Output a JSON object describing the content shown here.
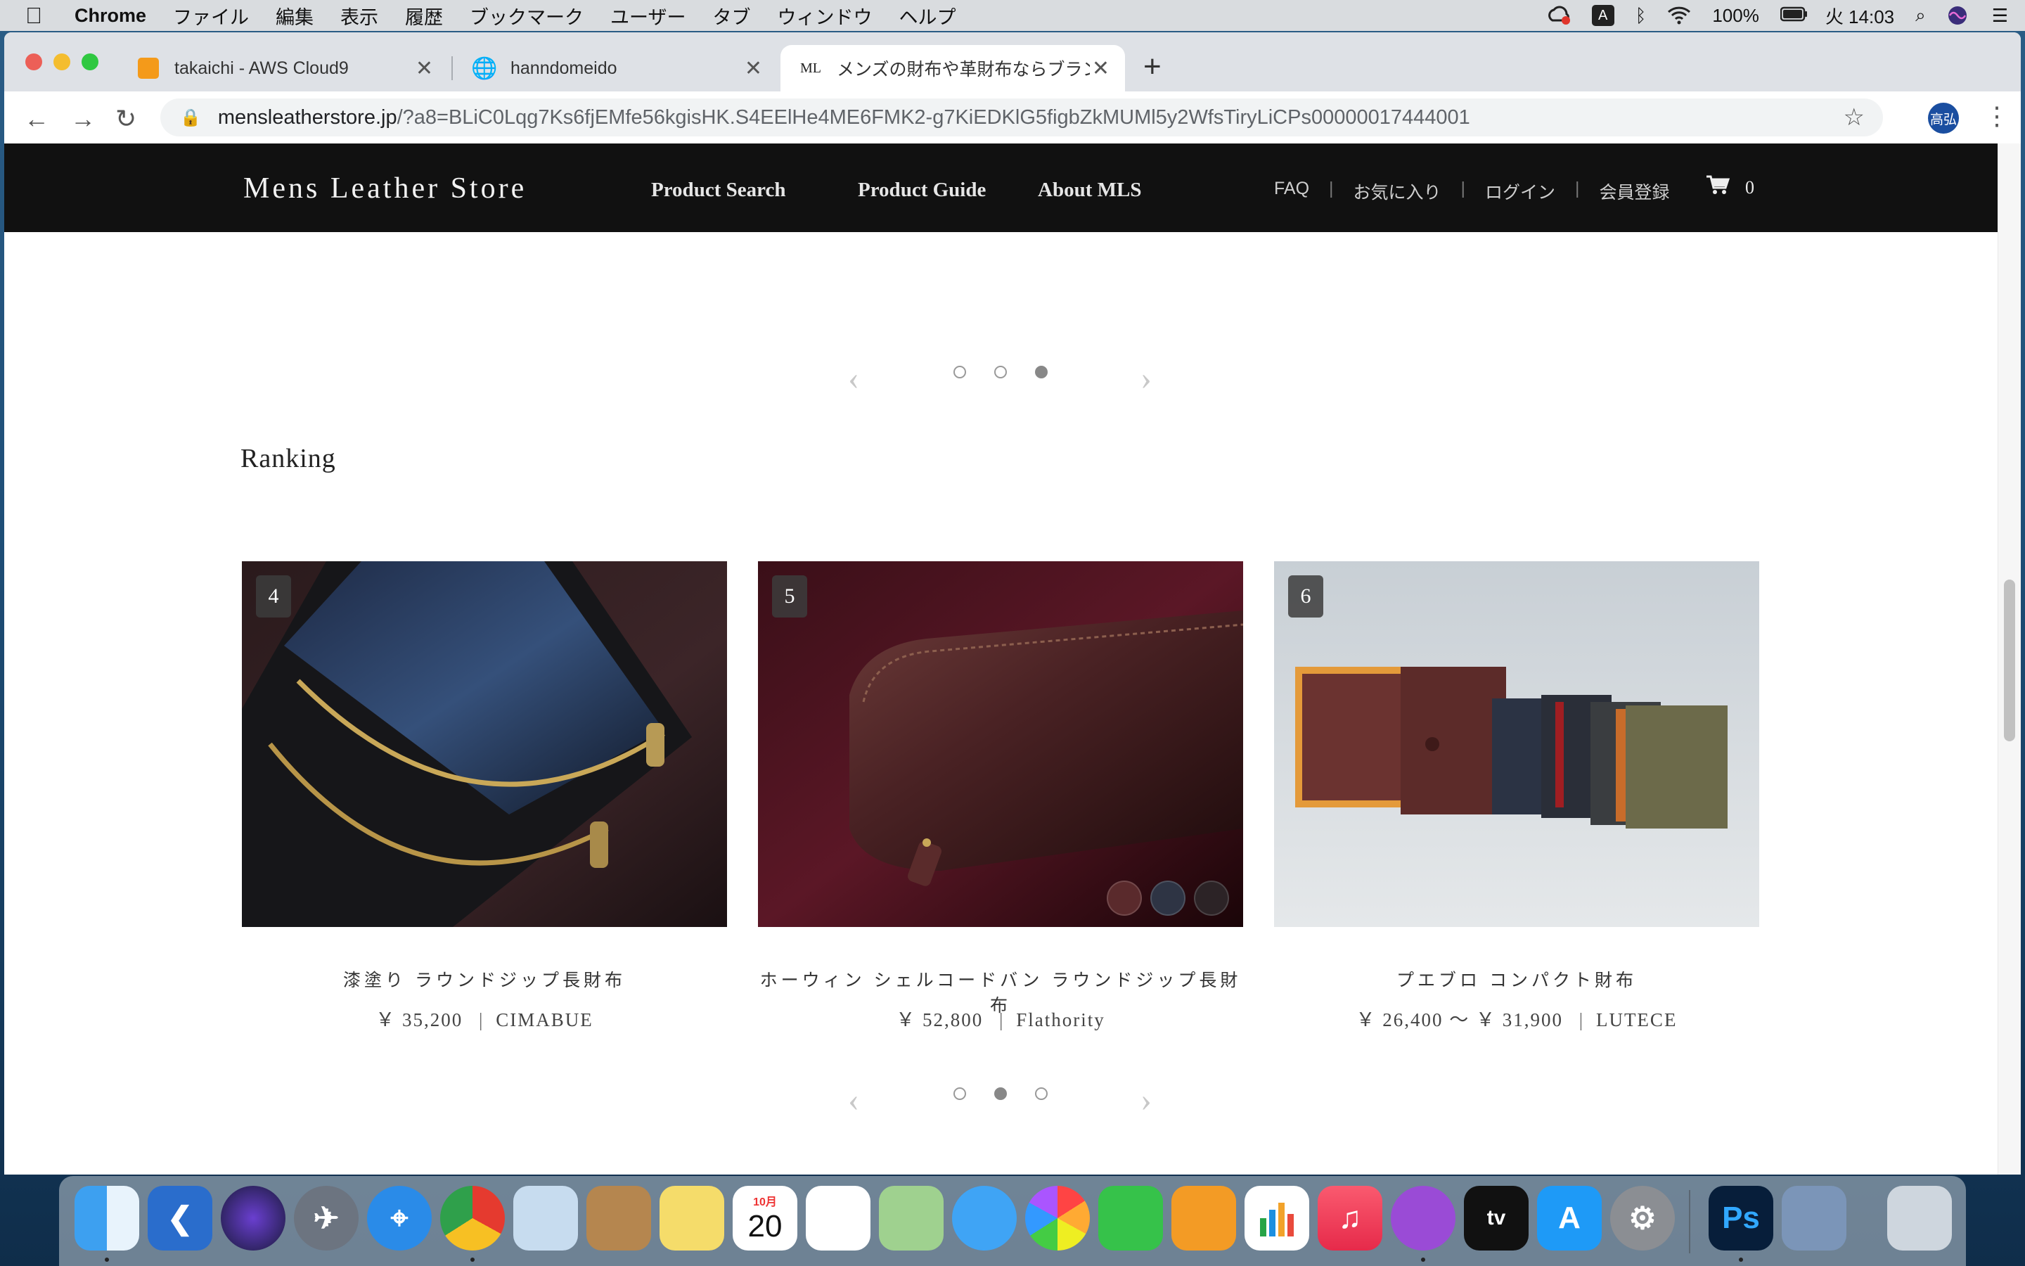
{
  "menubar": {
    "app": "Chrome",
    "items": [
      "ファイル",
      "編集",
      "表示",
      "履歴",
      "ブックマーク",
      "ユーザー",
      "タブ",
      "ウィンドウ",
      "ヘルプ"
    ],
    "input_mode": "A",
    "battery": "100%",
    "clock": "火 14:03"
  },
  "tabs": [
    {
      "title": "takaichi - AWS Cloud9",
      "icon": "cloud9-icon"
    },
    {
      "title": "hanndomeido",
      "icon": "globe-icon"
    },
    {
      "title": "メンズの財布や革財布ならブランド",
      "icon": "mls-favicon",
      "favicon_text": "ML"
    }
  ],
  "address": {
    "host": "mensleatherstore.jp",
    "path": "/?a8=BLiC0Lqg7Ks6fjEMfe56kgisHK.S4EElHe4ME6FMK2-g7KiEDKlG5figbZkMUMl5y2WfsTiryLiCPs00000017444001"
  },
  "profile": {
    "initials": "高弘"
  },
  "site": {
    "logo": "Mens Leather Store",
    "nav": [
      "Product Search",
      "Product Guide",
      "About MLS"
    ],
    "subnav": [
      "FAQ",
      "お気に入り",
      "ログイン",
      "会員登録"
    ],
    "cart_count": "0"
  },
  "top_pager": {
    "active": 3,
    "count": 3
  },
  "ranking": {
    "title": "Ranking",
    "products": [
      {
        "rank": "4",
        "name": "漆塗り ラウンドジップ長財布",
        "price": "￥ 35,200",
        "brand": "CIMABUE"
      },
      {
        "rank": "5",
        "name": "ホーウィン シェルコードバン ラウンドジップ長財布",
        "price": "￥ 52,800",
        "brand": "Flathority",
        "swatch_colors": [
          "#5a2a2c",
          "#2e3444",
          "#2c2326"
        ]
      },
      {
        "rank": "6",
        "name": "プエブロ コンパクト財布",
        "price": "￥ 26,400 〜 ￥ 31,900",
        "brand": "LUTECE"
      }
    ],
    "pager": {
      "active": 2,
      "count": 3
    }
  },
  "dock_apps": [
    "Finder",
    "Visual Studio Code",
    "Siri",
    "Launchpad",
    "Safari",
    "Chrome",
    "Mail",
    "Contacts",
    "Notes",
    "Calendar",
    "Reminders",
    "Maps",
    "Messages",
    "Photos",
    "FaceTime",
    "Pages",
    "Numbers",
    "Music",
    "Podcasts",
    "TV",
    "App Store",
    "System Preferences",
    "Photoshop",
    "Preview",
    "Trash"
  ],
  "dock_calendar": {
    "month": "10月",
    "day": "20"
  },
  "colors": {
    "site_header": "#111111",
    "accent_profile": "#1a4ea0"
  }
}
